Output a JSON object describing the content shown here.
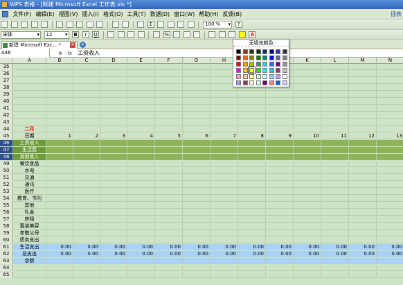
{
  "window": {
    "title": "WPS 表格 - [新建 Microsoft Excel 工作表.xls *]"
  },
  "menu": {
    "items": [
      "文件(F)",
      "编辑(E)",
      "视图(V)",
      "插入(I)",
      "格式(O)",
      "工具(T)",
      "数据(D)",
      "窗口(W)",
      "帮助(H)",
      "反馈(B)"
    ],
    "right_text": "插表"
  },
  "toolbar": {
    "zoom": "100 %",
    "font_name": "宋体",
    "font_size": "12",
    "bold": "B",
    "italic": "I",
    "underline": "U"
  },
  "doc_tab": {
    "label": "新建 Microsoft Exc... *"
  },
  "formula_bar": {
    "cell_ref": "A46",
    "fx": "fx",
    "content": "工资收入"
  },
  "palette": {
    "header": "无填充颜色",
    "colors": [
      [
        "#000000",
        "#993300",
        "#333300",
        "#003300",
        "#003366",
        "#000080",
        "#333399",
        "#333333"
      ],
      [
        "#800000",
        "#FF6600",
        "#808000",
        "#008000",
        "#008080",
        "#0000FF",
        "#666699",
        "#808080"
      ],
      [
        "#FF0000",
        "#FF9900",
        "#99CC00",
        "#339966",
        "#33CCCC",
        "#3366FF",
        "#800080",
        "#969696"
      ],
      [
        "#FF00FF",
        "#FFCC00",
        "#FFFF00",
        "#00FF00",
        "#00FFFF",
        "#00CCFF",
        "#993366",
        "#C0C0C0"
      ],
      [
        "#FF99CC",
        "#FFCC99",
        "#FFFF99",
        "#CCFFCC",
        "#CCFFFF",
        "#99CCFF",
        "#CC99FF",
        "#FFFFFF"
      ],
      [
        "#9999FF",
        "#993366",
        "#FFFFCC",
        "#CCFFFF",
        "#660066",
        "#FF8080",
        "#0066CC",
        "#CCCCFF"
      ]
    ]
  },
  "sheet": {
    "columns": [
      "A",
      "B",
      "C",
      "D",
      "E",
      "F",
      "G",
      "H",
      "I",
      "J",
      "K",
      "L",
      "M",
      "N"
    ],
    "rows": [
      {
        "n": "35",
        "cells": []
      },
      {
        "n": "36",
        "cells": []
      },
      {
        "n": "37",
        "cells": []
      },
      {
        "n": "38",
        "cells": []
      },
      {
        "n": "39",
        "cells": []
      },
      {
        "n": "40",
        "cells": []
      },
      {
        "n": "41",
        "cells": []
      },
      {
        "n": "42",
        "cells": []
      },
      {
        "n": "43",
        "cells": []
      },
      {
        "n": "44",
        "label": "二月",
        "label_color": "#ff0000",
        "cells": []
      },
      {
        "n": "45",
        "label": "日期",
        "cells": [
          "1",
          "2",
          "3",
          "4",
          "5",
          "6",
          "7",
          "8",
          "9",
          "10",
          "11",
          "12",
          "13"
        ]
      },
      {
        "n": "46",
        "label": "工资收入",
        "band": "green",
        "selected": true,
        "cells": []
      },
      {
        "n": "47",
        "label": "生活费",
        "band": "green",
        "selected": true,
        "cells": []
      },
      {
        "n": "48",
        "label": "其他收入",
        "band": "green",
        "selected": true,
        "cells": []
      },
      {
        "n": "49",
        "label": "餐饮食品",
        "cells": []
      },
      {
        "n": "50",
        "label": "水电",
        "cells": []
      },
      {
        "n": "51",
        "label": "交通",
        "cells": []
      },
      {
        "n": "52",
        "label": "通讯",
        "cells": []
      },
      {
        "n": "53",
        "label": "医疗",
        "cells": []
      },
      {
        "n": "54",
        "label": "教育、书刊",
        "cells": []
      },
      {
        "n": "55",
        "label": "其他",
        "cells": []
      },
      {
        "n": "56",
        "label": "礼金",
        "cells": []
      },
      {
        "n": "57",
        "label": "房租",
        "cells": []
      },
      {
        "n": "58",
        "label": "置装美容",
        "cells": []
      },
      {
        "n": "59",
        "label": "孝敬父母",
        "cells": []
      },
      {
        "n": "60",
        "label": "债务支出",
        "cells": []
      },
      {
        "n": "61",
        "label": "生活支出",
        "band": "blue",
        "cells": [
          "0.00",
          "0.00",
          "0.00",
          "0.00",
          "0.00",
          "0.00",
          "0.00",
          "0.00",
          "0.00",
          "0.00",
          "0.00",
          "0.00",
          "0.00"
        ]
      },
      {
        "n": "62",
        "label": "总支出",
        "band": "blue",
        "cells": [
          "0.00",
          "0.00",
          "0.00",
          "0.00",
          "0.00",
          "0.00",
          "0.00",
          "0.00",
          "0.00",
          "0.00",
          "0.00",
          "0.00",
          "0.00"
        ]
      },
      {
        "n": "63",
        "label": "余额",
        "band": "blue",
        "cells": []
      },
      {
        "n": "64",
        "cells": []
      },
      {
        "n": "65",
        "cells": []
      }
    ]
  }
}
